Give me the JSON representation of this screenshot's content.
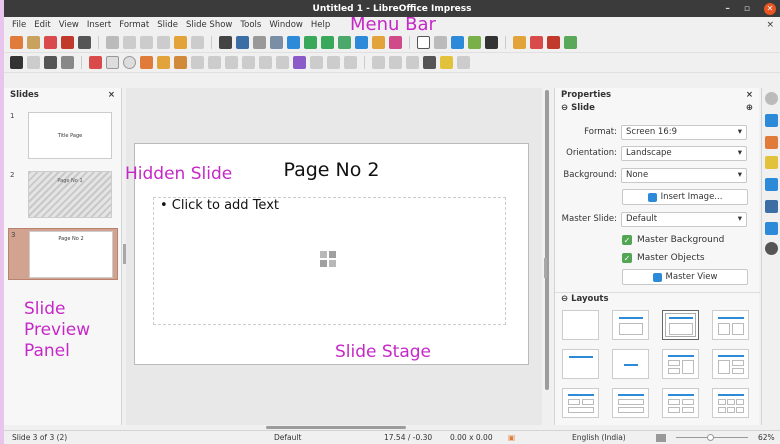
{
  "window": {
    "title": "Untitled 1 - LibreOffice Impress",
    "minimize": "–",
    "maximize": "▫",
    "close": "✕"
  },
  "menu": {
    "items": [
      "File",
      "Edit",
      "View",
      "Insert",
      "Format",
      "Slide",
      "Slide Show",
      "Tools",
      "Window",
      "Help"
    ],
    "close": "×"
  },
  "annotations": {
    "menu_bar": "Menu Bar",
    "hidden_slide": "Hidden Slide",
    "slide_preview_panel": [
      "Slide",
      "Preview",
      "Panel"
    ],
    "slide_stage": "Slide Stage"
  },
  "slides_panel": {
    "title": "Slides",
    "close": "×",
    "thumbs": [
      {
        "num": "1",
        "title": "Title Page"
      },
      {
        "num": "2",
        "title": "Page No 1"
      },
      {
        "num": "3",
        "title": "Page No 2"
      }
    ]
  },
  "stage": {
    "slide_title": "Page No 2",
    "text_placeholder": "• Click to add Text"
  },
  "properties": {
    "title": "Properties",
    "close": "×",
    "slide_section": "Slide",
    "format_label": "Format:",
    "format_value": "Screen 16:9",
    "orientation_label": "Orientation:",
    "orientation_value": "Landscape",
    "background_label": "Background:",
    "background_value": "None",
    "insert_image": "Insert Image...",
    "master_slide_label": "Master Slide:",
    "master_slide_value": "Default",
    "master_background": "Master Background",
    "master_objects": "Master Objects",
    "master_view": "Master View",
    "layouts_section": "Layouts"
  },
  "statusbar": {
    "slide_info": "Slide 3 of 3 (2)",
    "master": "Default",
    "position": "17.54 / -0.30",
    "size": "0.00 x 0.00",
    "language": "English (India)",
    "zoom": "62%"
  },
  "colors": {
    "accent_magenta": "#c628c8",
    "selection": "#d3a392",
    "checkbox": "#52a552"
  }
}
